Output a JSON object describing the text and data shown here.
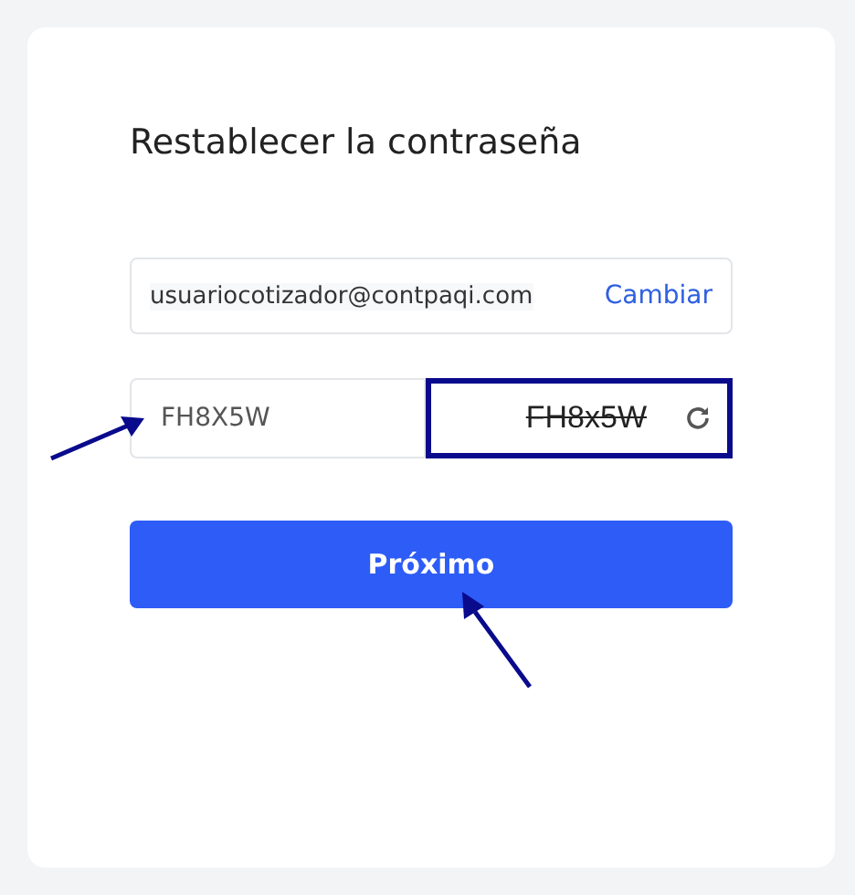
{
  "title": "Restablecer la contraseña",
  "email": {
    "value": "usuariocotizador@contpaqi.com",
    "action": "Cambiar"
  },
  "captcha": {
    "value": "FH8X5W",
    "image_text": "FH8x5W",
    "highlighted": true
  },
  "submit": {
    "label": "Próximo"
  }
}
